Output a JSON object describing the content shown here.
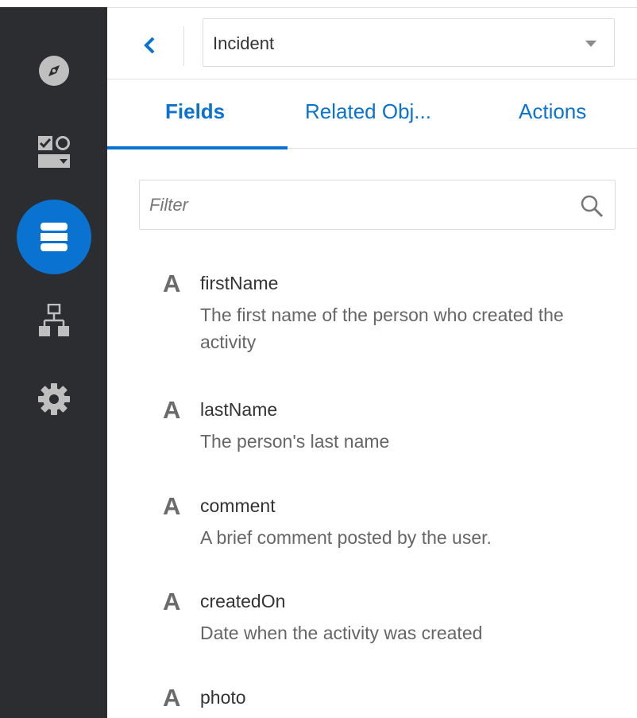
{
  "header": {
    "object_select_value": "Incident"
  },
  "tabs": [
    {
      "label": "Fields",
      "active": true
    },
    {
      "label": "Related Obj...",
      "active": false
    },
    {
      "label": "Actions",
      "active": false
    }
  ],
  "filter": {
    "placeholder": "Filter",
    "value": ""
  },
  "sidebar": {
    "items": [
      {
        "icon": "compass-icon"
      },
      {
        "icon": "form-controls-icon"
      },
      {
        "icon": "database-icon",
        "active": true
      },
      {
        "icon": "hierarchy-icon"
      },
      {
        "icon": "gear-icon"
      }
    ]
  },
  "fields": [
    {
      "type_icon": "A",
      "name": "firstName",
      "description": "The first name of the person who created the activity"
    },
    {
      "type_icon": "A",
      "name": "lastName",
      "description": "The person's last name"
    },
    {
      "type_icon": "A",
      "name": "comment",
      "description": "A brief comment posted by the user."
    },
    {
      "type_icon": "A",
      "name": "createdOn",
      "description": "Date when the activity was created"
    },
    {
      "type_icon": "A",
      "name": "photo",
      "description": ""
    }
  ],
  "colors": {
    "accent": "#0a72d1",
    "sidebar_bg": "#2b2d30",
    "sidebar_icon": "#bfbfbf"
  }
}
